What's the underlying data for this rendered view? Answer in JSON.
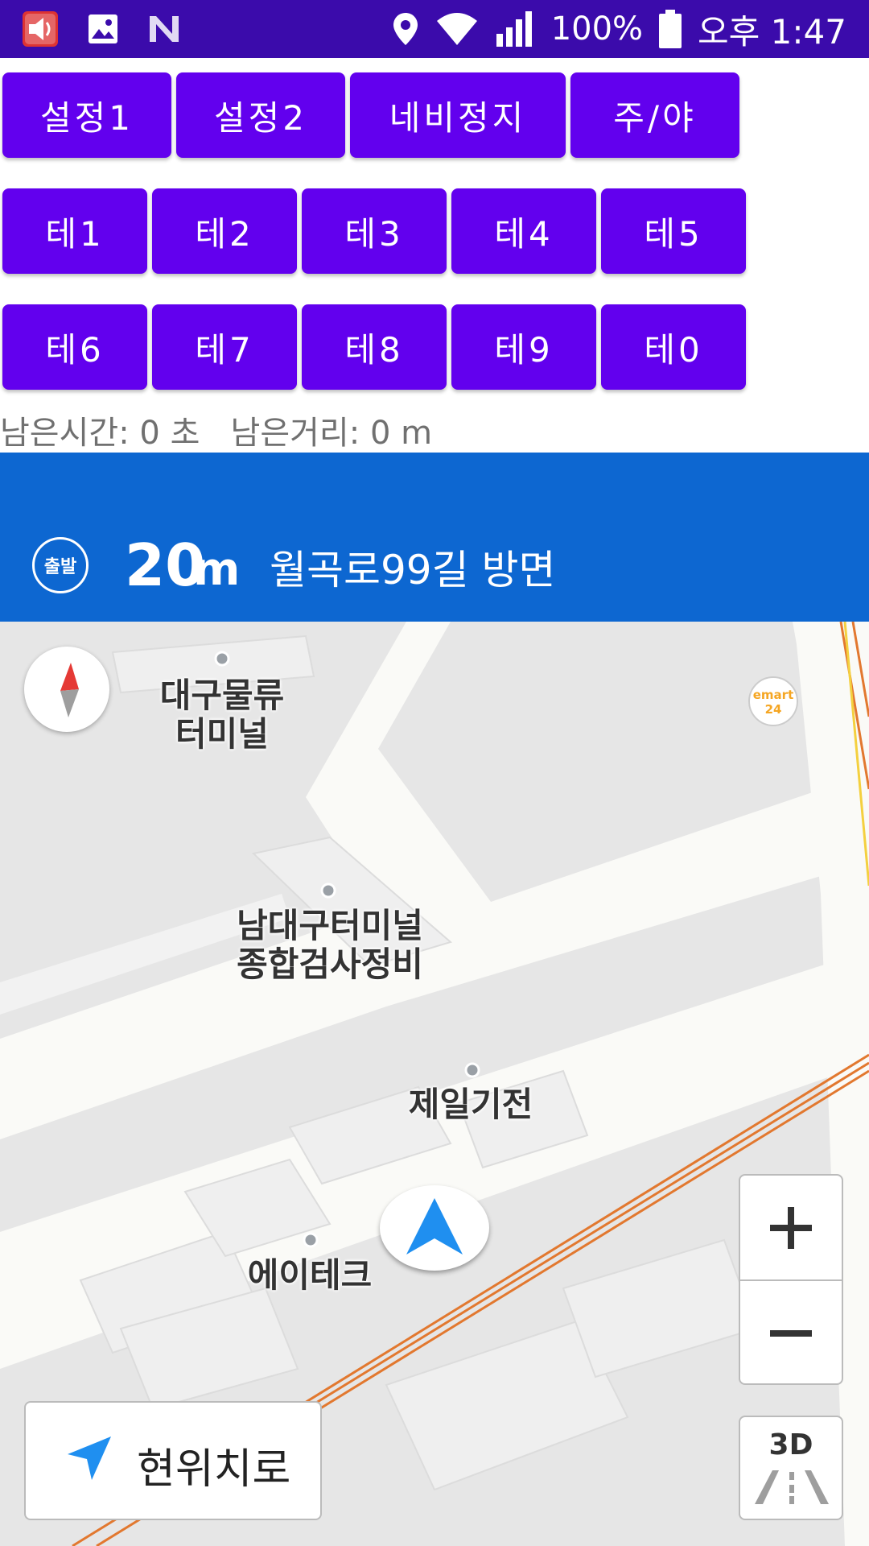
{
  "status_bar": {
    "battery": "100%",
    "time": "오후 1:47",
    "icons": [
      "volume-app-icon",
      "image-icon",
      "n-icon",
      "location-pin-icon",
      "wifi-icon",
      "signal-icon",
      "battery-icon"
    ]
  },
  "buttons": {
    "row1": [
      "설정1",
      "설정2",
      "네비정지",
      "주/야"
    ],
    "row2": [
      "테1",
      "테2",
      "테3",
      "테4",
      "테5"
    ],
    "row3": [
      "테6",
      "테7",
      "테8",
      "테9",
      "테0"
    ]
  },
  "info": {
    "remaining_time_label": "남은시간: ",
    "remaining_time_value": "0 초",
    "remaining_distance_label": "남은거리: ",
    "remaining_distance_value": "0 m"
  },
  "guidance": {
    "badge": "출발",
    "distance": "20",
    "unit": "m",
    "road": "월곡로99길 방면"
  },
  "map": {
    "pois": [
      "대구물류\n터미널",
      "남대구터미널\n종합검사정비",
      "제일기전",
      "에이테크"
    ],
    "emart": {
      "line1": "emart",
      "line2": "24"
    },
    "current_location_label": "현위치로",
    "label_3d": "3D"
  },
  "colors": {
    "status_bar": "#3b0bab",
    "button": "#6200ee",
    "banner": "#0d67d1",
    "nav_arrow": "#1f8ff0",
    "rail": "#e2782f"
  }
}
